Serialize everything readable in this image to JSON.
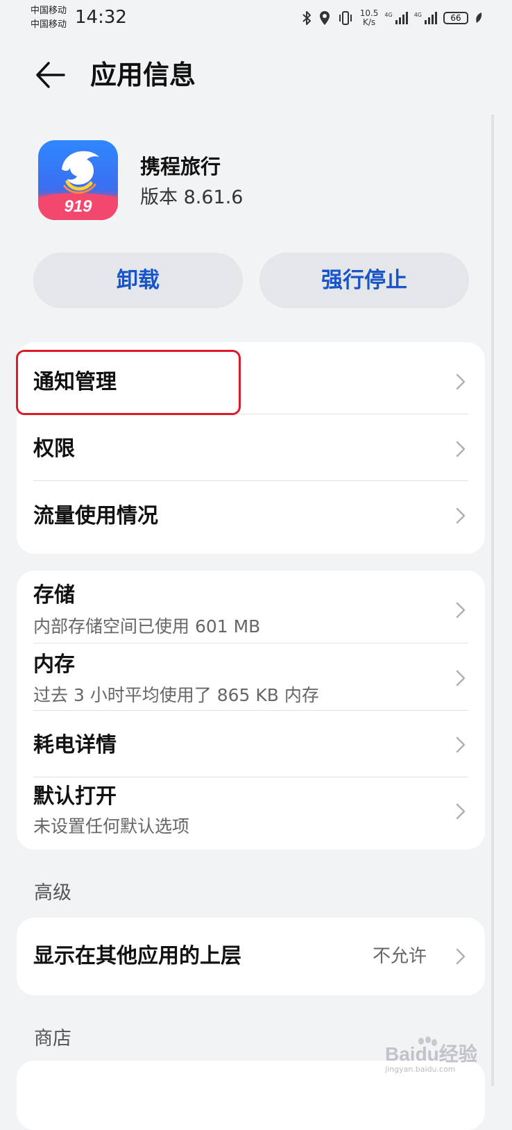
{
  "status_bar": {
    "carrier_1": "中国移动",
    "carrier_2": "中国移动",
    "time": "14:32",
    "net_speed_value": "10.5",
    "net_speed_unit": "K/s",
    "signal_1_label": "4G",
    "signal_2_label": "4G",
    "battery": "66",
    "icons": [
      "bluetooth-icon",
      "location-icon",
      "vibrate-icon",
      "signal-icon",
      "battery-icon",
      "leaf-icon"
    ]
  },
  "header": {
    "back_icon": "back-arrow-icon",
    "title": "应用信息"
  },
  "app": {
    "icon": "ctrip-dolphin-logo",
    "icon_badge": "919",
    "name": "携程旅行",
    "version": "版本 8.61.6"
  },
  "actions": {
    "uninstall": "卸载",
    "force_stop": "强行停止"
  },
  "group_1": {
    "items": [
      {
        "title": "通知管理"
      },
      {
        "title": "权限"
      },
      {
        "title": "流量使用情况"
      }
    ]
  },
  "group_2": {
    "items": [
      {
        "title": "存储",
        "subtitle": "内部存储空间已使用 601 MB"
      },
      {
        "title": "内存",
        "subtitle": "过去 3 小时平均使用了 865 KB 内存"
      },
      {
        "title": "耗电详情"
      },
      {
        "title": "默认打开",
        "subtitle": "未设置任何默认选项"
      }
    ]
  },
  "advanced": {
    "label": "高级",
    "items": [
      {
        "title": "显示在其他应用的上层",
        "value": "不允许"
      }
    ]
  },
  "store": {
    "label": "商店"
  },
  "colors": {
    "background": "#f1f3f5",
    "card": "#ffffff",
    "accent": "#1955c9",
    "highlight": "#d91b2a"
  },
  "watermark": {
    "logo_text": "Baidu经验",
    "url": "jingyan.baidu.com"
  }
}
